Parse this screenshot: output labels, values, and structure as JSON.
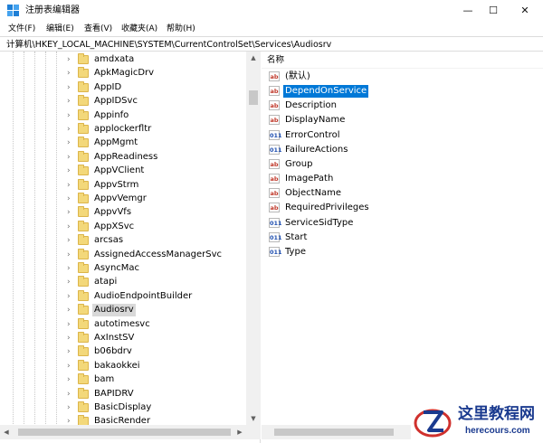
{
  "window": {
    "title": "注册表编辑器",
    "minimize_glyph": "—",
    "maximize_glyph": "☐",
    "close_glyph": "✕"
  },
  "menu": [
    {
      "label": "文件(F)"
    },
    {
      "label": "编辑(E)"
    },
    {
      "label": "查看(V)"
    },
    {
      "label": "收藏夹(A)"
    },
    {
      "label": "帮助(H)"
    }
  ],
  "address": "计算机\\HKEY_LOCAL_MACHINE\\SYSTEM\\CurrentControlSet\\Services\\Audiosrv",
  "tree": {
    "chevron_glyph": "›",
    "selected_index": 18,
    "items": [
      {
        "label": "amdxata"
      },
      {
        "label": "ApkMagicDrv"
      },
      {
        "label": "AppID"
      },
      {
        "label": "AppIDSvc"
      },
      {
        "label": "Appinfo"
      },
      {
        "label": "applockerfltr"
      },
      {
        "label": "AppMgmt"
      },
      {
        "label": "AppReadiness"
      },
      {
        "label": "AppVClient"
      },
      {
        "label": "AppvStrm"
      },
      {
        "label": "AppvVemgr"
      },
      {
        "label": "AppvVfs"
      },
      {
        "label": "AppXSvc"
      },
      {
        "label": "arcsas"
      },
      {
        "label": "AssignedAccessManagerSvc"
      },
      {
        "label": "AsyncMac"
      },
      {
        "label": "atapi"
      },
      {
        "label": "AudioEndpointBuilder"
      },
      {
        "label": "Audiosrv"
      },
      {
        "label": "autotimesvc"
      },
      {
        "label": "AxInstSV"
      },
      {
        "label": "b06bdrv"
      },
      {
        "label": "bakaokkei"
      },
      {
        "label": "bam"
      },
      {
        "label": "BAPIDRV"
      },
      {
        "label": "BasicDisplay"
      },
      {
        "label": "BasicRender"
      }
    ]
  },
  "values": {
    "column_header": "名称",
    "selected_index": 1,
    "items": [
      {
        "label": "(默认)",
        "icon": "string-value-icon",
        "glyph": "ab"
      },
      {
        "label": "DependOnService",
        "icon": "string-value-icon",
        "glyph": "ab"
      },
      {
        "label": "Description",
        "icon": "string-value-icon",
        "glyph": "ab"
      },
      {
        "label": "DisplayName",
        "icon": "string-value-icon",
        "glyph": "ab"
      },
      {
        "label": "ErrorControl",
        "icon": "binary-value-icon",
        "glyph": "011"
      },
      {
        "label": "FailureActions",
        "icon": "binary-value-icon",
        "glyph": "011"
      },
      {
        "label": "Group",
        "icon": "string-value-icon",
        "glyph": "ab"
      },
      {
        "label": "ImagePath",
        "icon": "string-value-icon",
        "glyph": "ab"
      },
      {
        "label": "ObjectName",
        "icon": "string-value-icon",
        "glyph": "ab"
      },
      {
        "label": "RequiredPrivileges",
        "icon": "string-value-icon",
        "glyph": "ab"
      },
      {
        "label": "ServiceSidType",
        "icon": "binary-value-icon",
        "glyph": "011"
      },
      {
        "label": "Start",
        "icon": "binary-value-icon",
        "glyph": "011"
      },
      {
        "label": "Type",
        "icon": "binary-value-icon",
        "glyph": "011"
      }
    ]
  },
  "scroll_glyphs": {
    "up": "▲",
    "down": "▼",
    "left": "◀",
    "right": "▶"
  },
  "watermark": {
    "title": "这里教程网",
    "url": "herecours.com",
    "brand_color": "#1a3a8f",
    "accent_color": "#d0312d"
  }
}
